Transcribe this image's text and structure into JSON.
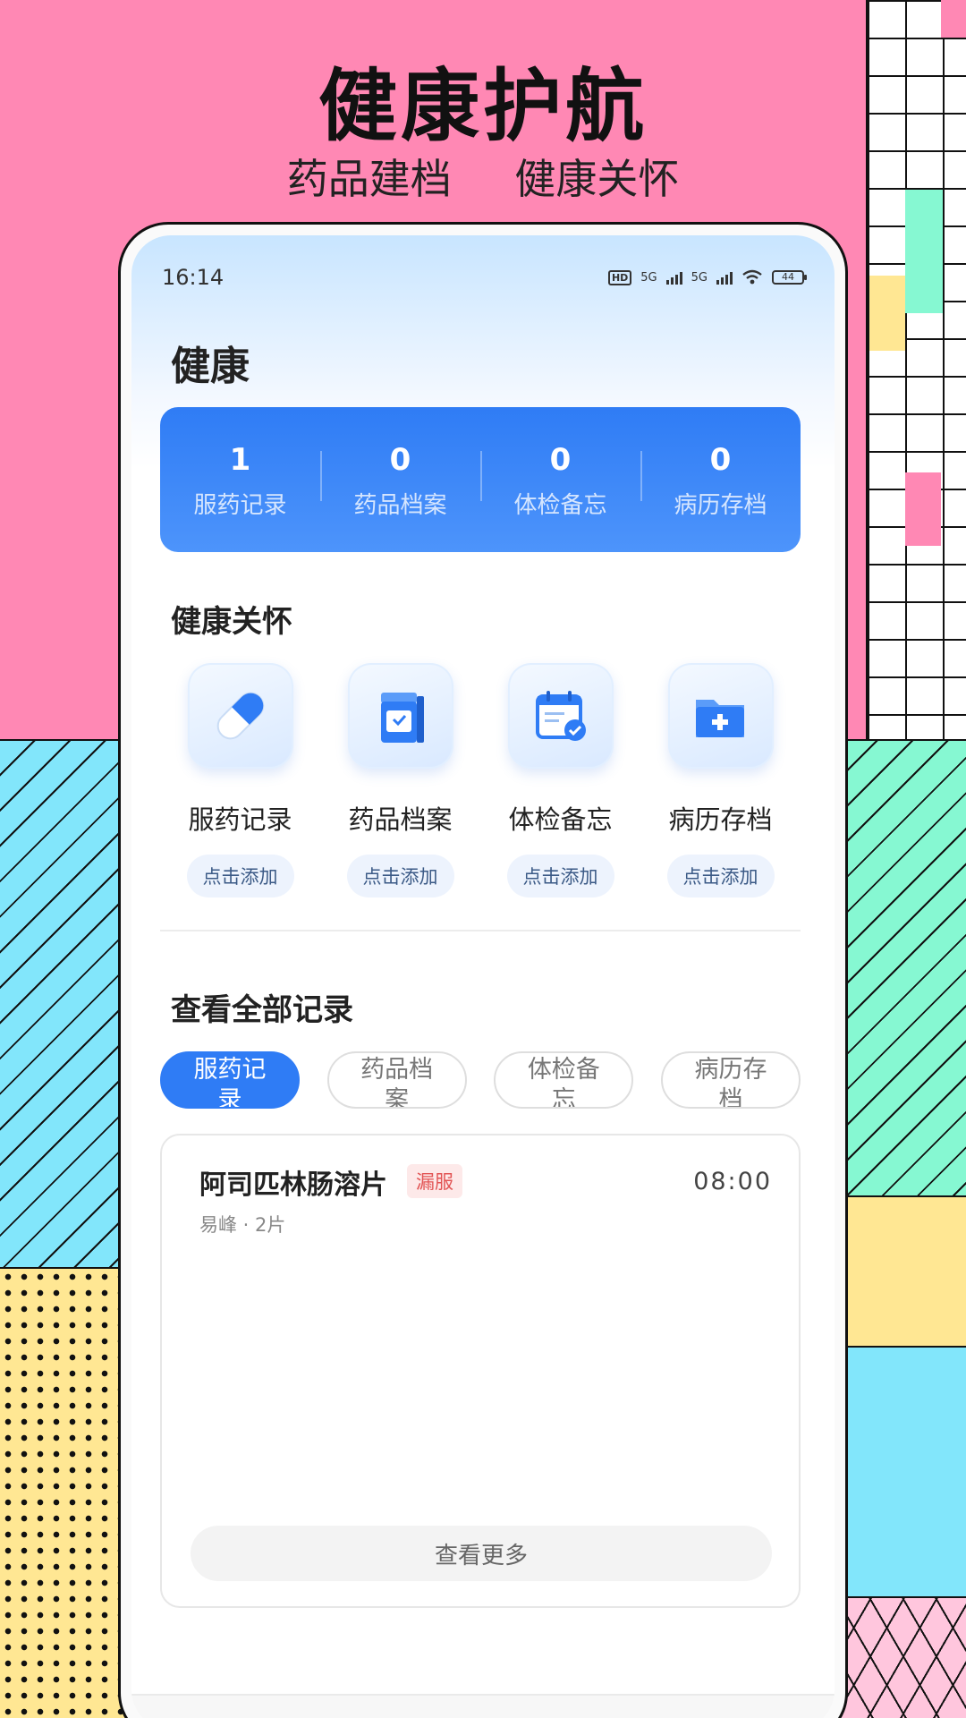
{
  "promo": {
    "headline": "健康护航",
    "sub_left": "药品建档",
    "sub_right": "健康关怀"
  },
  "status_bar": {
    "time": "16:14",
    "hd": "HD",
    "net1": "5G",
    "net2": "5G",
    "battery": "44"
  },
  "page": {
    "title": "健康"
  },
  "stats": [
    {
      "value": "1",
      "label": "服药记录"
    },
    {
      "value": "0",
      "label": "药品档案"
    },
    {
      "value": "0",
      "label": "体检备忘"
    },
    {
      "value": "0",
      "label": "病历存档"
    }
  ],
  "care": {
    "title": "健康关怀",
    "items": [
      {
        "label": "服药记录",
        "button": "点击添加",
        "icon": "capsule-icon"
      },
      {
        "label": "药品档案",
        "button": "点击添加",
        "icon": "medicine-box-icon"
      },
      {
        "label": "体检备忘",
        "button": "点击添加",
        "icon": "calendar-check-icon"
      },
      {
        "label": "病历存档",
        "button": "点击添加",
        "icon": "medical-folder-icon"
      }
    ]
  },
  "records": {
    "title": "查看全部记录",
    "tabs": [
      "服药记录",
      "药品档案",
      "体检备忘",
      "病历存档"
    ],
    "active_tab": 0,
    "items": [
      {
        "name": "阿司匹林肠溶片",
        "tag": "漏服",
        "time": "08:00",
        "detail": "易峰 · 2片"
      }
    ],
    "more_label": "查看更多"
  },
  "colors": {
    "accent": "#2f7cf5",
    "missed_tag": "#e25454",
    "background_pink": "#ff88b4"
  }
}
